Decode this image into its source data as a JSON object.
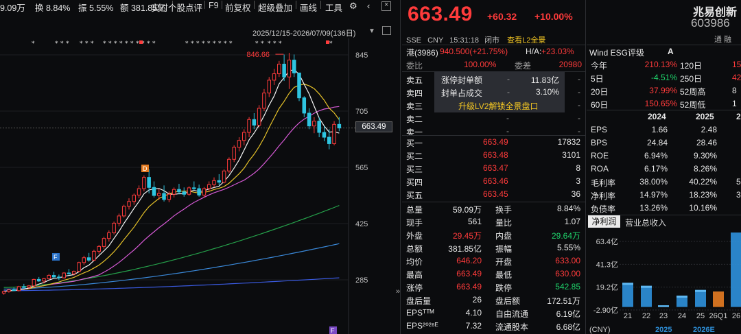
{
  "toolbar": {
    "vol_short": "9.09万",
    "turnover": "换 8.84%",
    "amplitude": "振 5.55%",
    "amount": "额 381.85亿",
    "btn_realtime": "实时个股点评",
    "btn_f9": "F9",
    "btn_fq": "前复权",
    "btn_overlay": "超级叠加",
    "btn_draw": "画线",
    "btn_tools": "工具"
  },
  "chart": {
    "range": "2025/12/15-2026/07/09(136日)",
    "high_label": "846.66",
    "price_tag": "663.49",
    "y_ticks": [
      "845",
      "705",
      "565",
      "425",
      "285"
    ],
    "markers": {
      "d": "D",
      "f1": "F",
      "f2": "F"
    },
    "colors": {
      "up": "#ff3b3b",
      "down": "#2ec4e0",
      "ma5": "#f5f5f5",
      "ma10": "#e6c229",
      "ma20": "#d75ad6",
      "ma60": "#25a04a",
      "ma120": "#3a88d8",
      "ma250": "#3a5ae0"
    }
  },
  "chart_data": {
    "type": "candlestick",
    "ylim": [
      250,
      900
    ],
    "x_count": 68,
    "candles": [
      [
        252,
        258,
        248,
        256
      ],
      [
        256,
        262,
        253,
        260
      ],
      [
        260,
        266,
        257,
        258
      ],
      [
        258,
        270,
        256,
        268
      ],
      [
        268,
        275,
        264,
        266
      ],
      [
        266,
        272,
        262,
        270
      ],
      [
        270,
        288,
        268,
        286
      ],
      [
        286,
        292,
        280,
        282
      ],
      [
        282,
        290,
        276,
        288
      ],
      [
        288,
        300,
        285,
        296
      ],
      [
        296,
        305,
        290,
        292
      ],
      [
        292,
        298,
        284,
        290
      ],
      [
        290,
        304,
        288,
        302
      ],
      [
        302,
        312,
        298,
        300
      ],
      [
        300,
        308,
        296,
        306
      ],
      [
        306,
        330,
        304,
        328
      ],
      [
        328,
        345,
        322,
        340
      ],
      [
        340,
        352,
        330,
        334
      ],
      [
        334,
        360,
        332,
        356
      ],
      [
        356,
        372,
        350,
        368
      ],
      [
        368,
        392,
        362,
        388
      ],
      [
        388,
        408,
        380,
        402
      ],
      [
        402,
        430,
        398,
        426
      ],
      [
        426,
        450,
        418,
        444
      ],
      [
        444,
        472,
        440,
        468
      ],
      [
        468,
        488,
        460,
        480
      ],
      [
        480,
        500,
        472,
        496
      ],
      [
        496,
        520,
        488,
        512
      ],
      [
        512,
        545,
        505,
        540
      ],
      [
        540,
        560,
        500,
        515
      ],
      [
        515,
        530,
        490,
        495
      ],
      [
        495,
        512,
        484,
        500
      ],
      [
        500,
        520,
        480,
        485
      ],
      [
        485,
        505,
        478,
        498
      ],
      [
        498,
        515,
        490,
        510
      ],
      [
        510,
        524,
        498,
        504
      ],
      [
        504,
        515,
        492,
        498
      ],
      [
        498,
        518,
        494,
        514
      ],
      [
        514,
        530,
        508,
        512
      ],
      [
        512,
        522,
        492,
        496
      ],
      [
        496,
        516,
        490,
        512
      ],
      [
        512,
        530,
        505,
        522
      ],
      [
        522,
        540,
        515,
        532
      ],
      [
        532,
        548,
        520,
        528
      ],
      [
        528,
        560,
        525,
        556
      ],
      [
        556,
        590,
        550,
        585
      ],
      [
        585,
        620,
        578,
        615
      ],
      [
        615,
        640,
        605,
        632
      ],
      [
        632,
        660,
        620,
        652
      ],
      [
        652,
        690,
        640,
        684
      ],
      [
        684,
        700,
        660,
        670
      ],
      [
        670,
        720,
        665,
        712
      ],
      [
        712,
        760,
        705,
        750
      ],
      [
        750,
        790,
        740,
        782
      ],
      [
        782,
        810,
        770,
        798
      ],
      [
        798,
        830,
        790,
        822
      ],
      [
        822,
        846,
        780,
        790
      ],
      [
        790,
        850,
        760,
        832
      ],
      [
        832,
        846,
        790,
        800
      ],
      [
        800,
        770,
        730,
        738
      ],
      [
        738,
        742,
        690,
        700
      ],
      [
        700,
        712,
        660,
        668
      ],
      [
        668,
        690,
        650,
        680
      ],
      [
        680,
        690,
        640,
        652
      ],
      [
        652,
        668,
        630,
        640
      ],
      [
        640,
        660,
        610,
        624
      ],
      [
        624,
        680,
        620,
        672
      ],
      [
        672,
        690,
        655,
        663
      ]
    ],
    "ma60_end": 470,
    "ma120_end": 375,
    "ma250_end": 290
  },
  "quote": {
    "price": "663.49",
    "change": "+60.32",
    "pct": "+10.00%",
    "exchange": "SSE",
    "currency": "CNY",
    "time": "15:31:18",
    "status": "闭市",
    "l2_link": "查看L2全景",
    "hk_label": "港(3986)",
    "hk_price": "940.500(+21.75%)",
    "ha_label": "H/A:",
    "ha_value": "+23.03%",
    "weibi_label": "委比",
    "weibi": "100.00%",
    "weicha_label": "委差",
    "weicha": "20980",
    "asks": [
      {
        "label": "卖五",
        "price": "-",
        "vol": "-"
      },
      {
        "label": "卖四",
        "price": "-",
        "vol": "-"
      },
      {
        "label": "卖三",
        "price": "-",
        "vol": "-"
      },
      {
        "label": "卖二",
        "price": "-",
        "vol": "-"
      },
      {
        "label": "卖一",
        "price": "-",
        "vol": "-"
      }
    ],
    "l2": {
      "r1_label": "涨停封单额",
      "r1_dash": "-",
      "r1_value": "11.83亿",
      "r2_label": "封单占成交",
      "r2_dash": "-",
      "r2_value": "3.10%",
      "unlock": "升级LV2解锁全景盘口"
    },
    "bids": [
      {
        "label": "买一",
        "price": "663.49",
        "vol": "17832"
      },
      {
        "label": "买二",
        "price": "663.48",
        "vol": "3101"
      },
      {
        "label": "买三",
        "price": "663.47",
        "vol": "8"
      },
      {
        "label": "买四",
        "price": "663.46",
        "vol": "3"
      },
      {
        "label": "买五",
        "price": "663.45",
        "vol": "36"
      }
    ],
    "stats": [
      {
        "l1": "总量",
        "v1": "59.09万",
        "c1": "white",
        "l2": "换手",
        "v2": "8.84%",
        "c2": "white"
      },
      {
        "l1": "现手",
        "v1": "561",
        "c1": "white",
        "l2": "量比",
        "v2": "1.07",
        "c2": "white"
      },
      {
        "l1": "外盘",
        "v1": "29.45万",
        "c1": "red",
        "l2": "内盘",
        "v2": "29.64万",
        "c2": "green"
      },
      {
        "l1": "总额",
        "v1": "381.85亿",
        "c1": "white",
        "l2": "振幅",
        "v2": "5.55%",
        "c2": "white"
      },
      {
        "l1": "均价",
        "v1": "646.20",
        "c1": "red",
        "l2": "开盘",
        "v2": "633.00",
        "c2": "red"
      },
      {
        "l1": "最高",
        "v1": "663.49",
        "c1": "red",
        "l2": "最低",
        "v2": "630.00",
        "c2": "red"
      },
      {
        "l1": "涨停",
        "v1": "663.49",
        "c1": "red",
        "l2": "跌停",
        "v2": "542.85",
        "c2": "green"
      },
      {
        "l1": "盘后量",
        "v1": "26",
        "c1": "white",
        "l2": "盘后额",
        "v2": "172.51万",
        "c2": "white"
      },
      {
        "l1": "EPSᵀᵀᴹ",
        "v1": "4.10",
        "c1": "white",
        "l2": "自由流通",
        "v2": "6.19亿",
        "c2": "white"
      },
      {
        "l1": "EPS²⁰²⁶ᴱ",
        "v1": "7.32",
        "c1": "white",
        "l2": "流通股本",
        "v2": "6.68亿",
        "c2": "white"
      }
    ]
  },
  "info": {
    "name": "兆易创新",
    "code": "603986",
    "tags": "通 融",
    "esg_label": "Wind ESG评级",
    "esg_value": "A",
    "returns": [
      {
        "l1": "今年",
        "v1": "210.13%",
        "c1": "red",
        "l2": "120日",
        "v2": "15",
        "c2": "red"
      },
      {
        "l1": "5日",
        "v1": "-4.51%",
        "c1": "green",
        "l2": "250日",
        "v2": "42",
        "c2": "red"
      },
      {
        "l1": "20日",
        "v1": "37.99%",
        "c1": "red",
        "l2": "52周高",
        "v2": "8",
        "c2": "white"
      },
      {
        "l1": "60日",
        "v1": "150.65%",
        "c1": "red",
        "l2": "52周低",
        "v2": "1",
        "c2": "white"
      }
    ],
    "fin_years": [
      "2024",
      "2025",
      "2"
    ],
    "fin_rows": [
      {
        "label": "EPS",
        "a": "1.66",
        "b": "2.48",
        "c": "",
        "col": "white"
      },
      {
        "label": "BPS",
        "a": "24.84",
        "b": "28.46",
        "c": "",
        "col": "white"
      },
      {
        "label": "ROE",
        "a": "6.94%",
        "b": "9.30%",
        "c": "",
        "col": "white"
      },
      {
        "label": "ROA",
        "a": "6.17%",
        "b": "8.26%",
        "c": "",
        "col": "white"
      },
      {
        "label": "毛利率",
        "a": "38.00%",
        "b": "40.22%",
        "c": "5",
        "col": "white"
      },
      {
        "label": "净利率",
        "a": "14.97%",
        "b": "18.23%",
        "c": "3",
        "col": "white"
      },
      {
        "label": "负债率",
        "a": "13.26%",
        "b": "10.16%",
        "c": "",
        "col": "white"
      }
    ],
    "tab_profit": "净利润",
    "tab_revenue": "营业总收入",
    "bar_y_ticks": [
      "63.4亿",
      "41.3亿",
      "19.2亿",
      "-2.90亿"
    ],
    "bar_x_labels": [
      "21",
      "22",
      "23",
      "24",
      "25",
      "26Q1",
      "26"
    ],
    "bar_unit": "(CNY)",
    "bar_years": [
      "2025",
      "2026E"
    ]
  },
  "bar_chart_data": {
    "type": "bar",
    "categories": [
      "21",
      "22",
      "23",
      "24",
      "25",
      "26Q1",
      "26"
    ],
    "values": [
      23.4,
      20.5,
      1.6,
      11.0,
      16.5,
      15.0,
      72.0
    ],
    "ylim": [
      -2.9,
      63.4
    ]
  }
}
